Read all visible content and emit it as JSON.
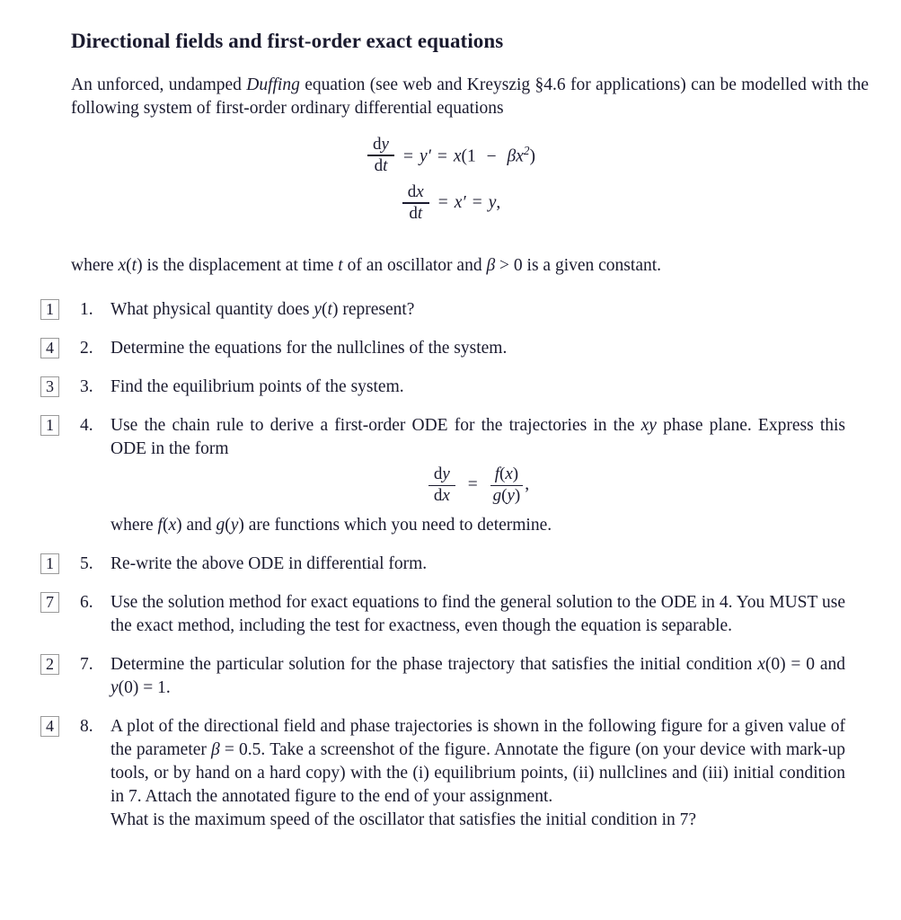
{
  "document": {
    "title": "Directional fields and first-order exact equations",
    "intro": {
      "line1": "An unforced, undamped ",
      "emphasis": "Duffing",
      "line1b": " equation (see web and Kreyszig §4.6 for applications) can be",
      "line2": "modelled with the following system of first-order ordinary differential equations"
    },
    "system_equations": {
      "eq1": {
        "frac_num": "dy",
        "frac_den": "dt",
        "rhs": "= y′ = x(1 − βx²)"
      },
      "eq2": {
        "frac_num": "dx",
        "frac_den": "dt",
        "rhs": "= x′ = y,"
      }
    },
    "where_line": "where x(t) is the displacement at time t of an oscillator and β > 0 is a given constant.",
    "questions": [
      {
        "marks": "1",
        "number": "1.",
        "text": "What physical quantity does y(t) represent?"
      },
      {
        "marks": "4",
        "number": "2.",
        "text": "Determine the equations for the nullclines of the system."
      },
      {
        "marks": "3",
        "number": "3.",
        "text": "Find the equilibrium points of the system."
      },
      {
        "marks": "1",
        "number": "4.",
        "text": "Use the chain rule to derive a first-order ODE for the trajectories in the xy phase plane. Express this ODE in the form",
        "equation": {
          "lhs_num": "dy",
          "lhs_den": "dx",
          "op": "=",
          "rhs_num": "f(x)",
          "rhs_den": "g(y)",
          "tail": ","
        },
        "text_after": "where f(x) and g(y) are functions which you need to determine."
      },
      {
        "marks": "1",
        "number": "5.",
        "text": "Re-write the above ODE in differential form."
      },
      {
        "marks": "7",
        "number": "6.",
        "text": "Use the solution method for exact equations to find the general solution to the ODE in 4. You MUST use the exact method, including the test for exactness, even though the equation is separable."
      },
      {
        "marks": "2",
        "number": "7.",
        "text": "Determine the particular solution for the phase trajectory that satisfies the initial condition x(0) = 0 and y(0) = 1."
      },
      {
        "marks": "4",
        "number": "8.",
        "text": "A plot of the directional field and phase trajectories is shown in the following figure for a given value of the parameter β = 0.5. Take a screenshot of the figure. Annotate the figure (on your device with mark-up tools, or by hand on a hard copy) with the (i) equilibrium points, (ii) nullclines and (iii) initial condition in 7. Attach the annotated figure to the end of your assignment.",
        "text_after": "What is the maximum speed of the oscillator that satisfies the initial condition in 7?"
      }
    ],
    "colors": {
      "text": "#1a1a2e",
      "mark_box_border": "#9a9a9a",
      "page_background": "#ffffff"
    }
  }
}
